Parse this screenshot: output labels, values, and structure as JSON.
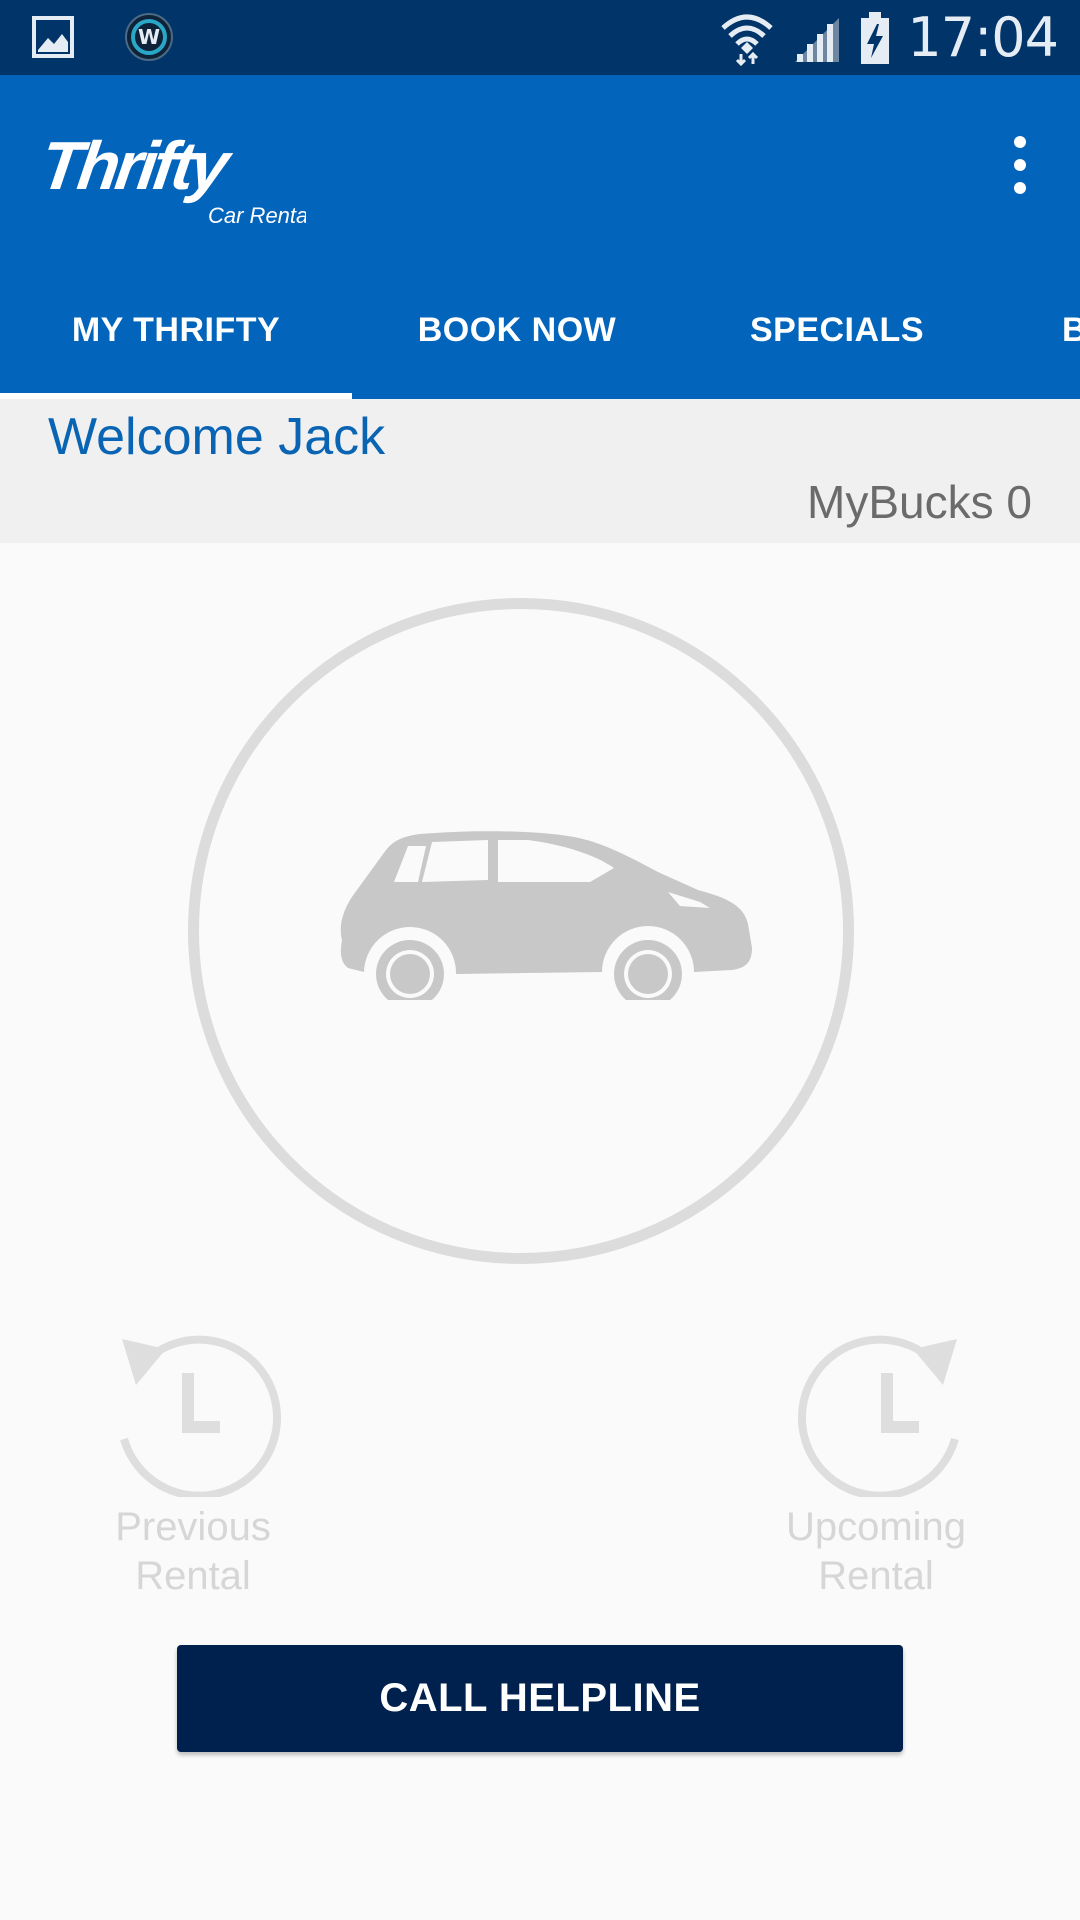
{
  "status_bar": {
    "time": "17:04",
    "icons": [
      "gallery-icon",
      "w-app-icon",
      "wifi-icon",
      "signal-icon",
      "battery-charging-icon"
    ]
  },
  "app_bar": {
    "logo_text": "Thrifty",
    "logo_subtext": "Car Rental",
    "menu_icon": "more-vert-icon"
  },
  "tabs": [
    {
      "label": "MY THRIFTY",
      "selected": true
    },
    {
      "label": "BOOK NOW",
      "selected": false
    },
    {
      "label": "SPECIALS",
      "selected": false
    },
    {
      "label": "B",
      "selected": false
    }
  ],
  "welcome": {
    "greeting": "Welcome Jack",
    "mybucks": "MyBucks 0"
  },
  "rentals": {
    "previous": {
      "line1": "Previous",
      "line2": "Rental",
      "icon": "history-back-icon"
    },
    "upcoming": {
      "line1": "Upcoming",
      "line2": "Rental",
      "icon": "history-forward-icon"
    }
  },
  "call_button": {
    "label": "CALL HELPLINE"
  },
  "colors": {
    "status_bar": "#013468",
    "app_bar": "#0364bb",
    "welcome_text": "#0a64b4",
    "button": "#00204d"
  }
}
